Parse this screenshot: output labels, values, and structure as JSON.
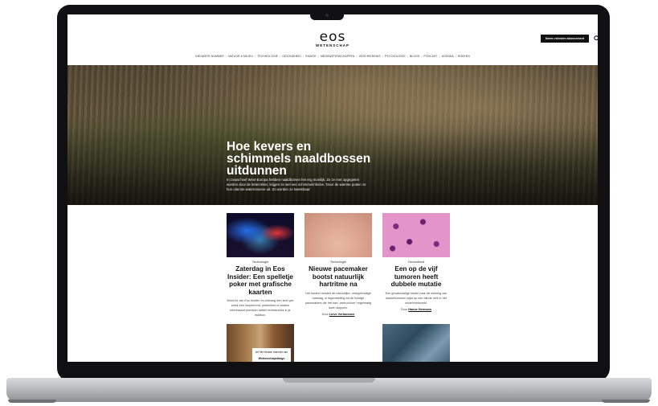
{
  "header": {
    "logo": "eos",
    "logo_sub": "WETENSCHAP",
    "subscribe_button": "Neem vrienden abonnement",
    "search_icon": "search-icon"
  },
  "nav": {
    "items": [
      "NIEUWSTE NUMMER",
      "NATUUR & MILIEU",
      "TECHNOLOGIE",
      "GEZONDHEID",
      "RUIMTE",
      "MENSWETENSCHAPPEN",
      "GESCHIEDENIS",
      "PSYCHOLOGIE",
      "BLOGS",
      "PODCAST",
      "AGENDA",
      "BOEKEN"
    ],
    "separator": "•"
  },
  "hero": {
    "title": "Hoe kevers en schimmels naaldbossen uitdunnen",
    "text": "In zowat heel West-Europa hebben naaldbomen het erg moeilijk. Ze ze met opgegeten worden door de letterzetter, krijgen ze wel een schimmelinfectie. 'Door de warmte putten ze hun uiterste waterreserve uit. Zo worden ze kwetsbaar.'"
  },
  "cards": [
    {
      "category": "Technologie",
      "title": "Zaterdag in Eos Insider: Een spelletje poker met grafische kaarten",
      "text": "Word lid van Eos Insider en ontvang één keer per week een inspirerend, prikkelend of anders interessant premium artikel rechtstreeks in je mailbox.",
      "author_prefix": "",
      "author": ""
    },
    {
      "category": "Technologie",
      "title": "Nieuwe pacemaker bootst natuurlijk hartritme na",
      "text": "Het toestel herstelt de natuurlijke, onregelmatige hartslag, in tegenstelling tot de huidige pacemakers die het hart „metronoom“ regelmatig doen kloppen.",
      "author_prefix": "Door",
      "author": "Lieve Vertommen"
    },
    {
      "category": "Gezondheid",
      "title": "Een op de vijf tumoren heeft dubbele mutatie",
      "text": "Een grootschalige studie naar de werking van kankertumoren wijst op een blinde vlek in het onderzoeksveld.",
      "author_prefix": "Door",
      "author": "Hanne Hermans"
    }
  ],
  "bottom_cards": [
    {
      "tag_line1": "Uit het nieuwe nummer van",
      "tag_line2": "Wetenschapsblogs"
    },
    {}
  ]
}
